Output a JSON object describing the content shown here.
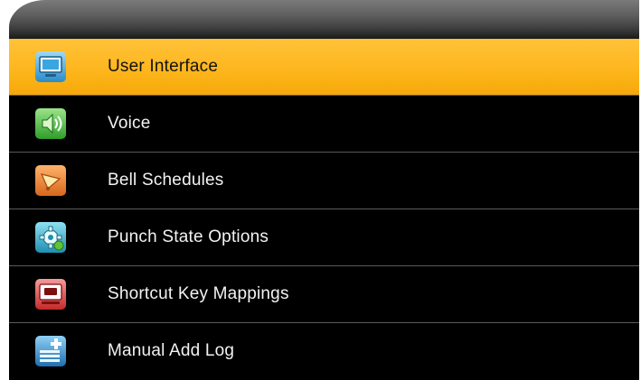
{
  "menu": {
    "items": [
      {
        "label": "User Interface",
        "icon": "monitor-icon",
        "selected": true
      },
      {
        "label": "Voice",
        "icon": "speaker-icon",
        "selected": false
      },
      {
        "label": "Bell Schedules",
        "icon": "bell-icon",
        "selected": false
      },
      {
        "label": "Punch State Options",
        "icon": "gear-icon",
        "selected": false
      },
      {
        "label": "Shortcut Key Mappings",
        "icon": "keyboard-key-icon",
        "selected": false
      },
      {
        "label": "Manual Add Log",
        "icon": "add-log-icon",
        "selected": false
      }
    ]
  },
  "colors": {
    "highlight": "#fdb51b",
    "background": "#000000",
    "text": "#f2f2f2"
  }
}
